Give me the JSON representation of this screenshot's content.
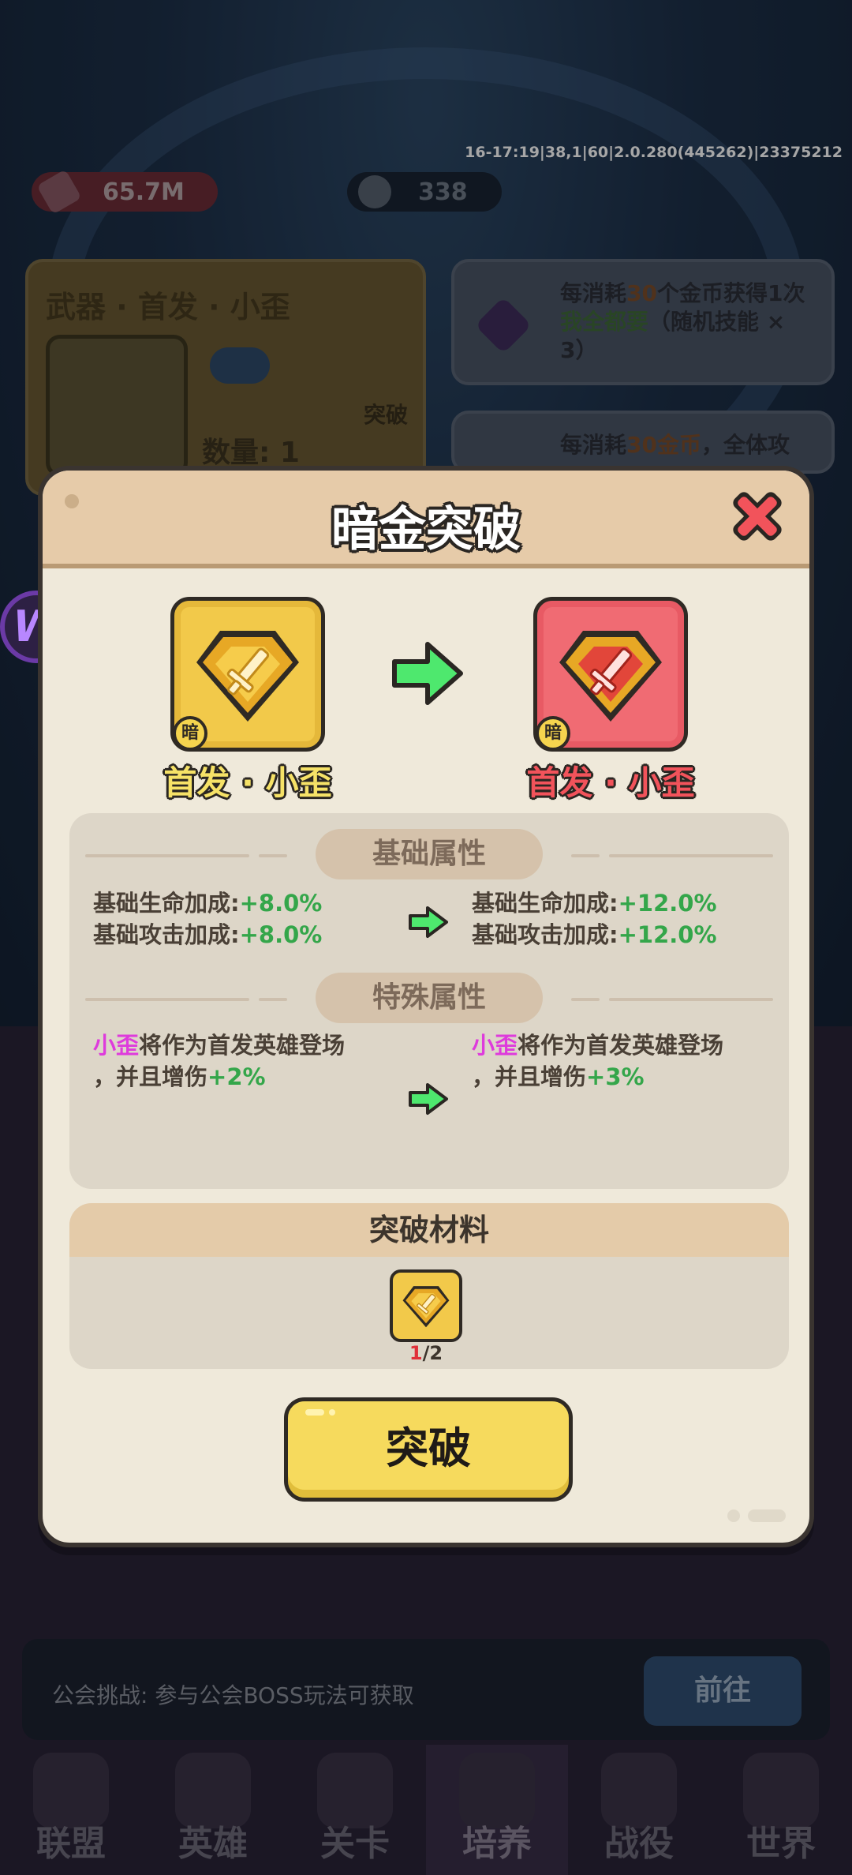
{
  "status": {
    "version_text": "16-17:19|38,1|60|2.0.280(445262)|23375212"
  },
  "top_bar": {
    "power": "65.7M",
    "gems": "338"
  },
  "weapon_card": {
    "title": "武器 · 首发 · 小歪",
    "quantity_label": "数量: 1",
    "breakthrough_label": "突破"
  },
  "offers": [
    {
      "prefix": "每消耗",
      "amount": "30",
      "middle": "个金币获得1次",
      "highlight": "我全都要",
      "rest": "（随机技能 × 3）"
    },
    {
      "prefix": "每消耗",
      "amount": "30金币",
      "rest": "，全体攻"
    }
  ],
  "side_badge": "W",
  "modal": {
    "title": "暗金突破",
    "tag": "暗",
    "from_name": "首发 · 小歪",
    "to_name": "首发 · 小歪",
    "base_section": "基础属性",
    "special_section": "特殊属性",
    "base_before": [
      {
        "label": "基础生命加成:",
        "value": "+8.0%"
      },
      {
        "label": "基础攻击加成:",
        "value": "+8.0%"
      }
    ],
    "base_after": [
      {
        "label": "基础生命加成:",
        "value": "+12.0%"
      },
      {
        "label": "基础攻击加成:",
        "value": "+12.0%"
      }
    ],
    "special_before": {
      "hero": "小歪",
      "text1": "将作为首发英雄登场",
      "text2": "，并且增伤",
      "value": "+2%"
    },
    "special_after": {
      "hero": "小歪",
      "text1": "将作为首发英雄登场",
      "text2": "，并且增伤",
      "value": "+3%"
    },
    "material_title": "突破材料",
    "material_have": "1",
    "material_need": "/2",
    "button_label": "突破"
  },
  "guild": {
    "text": "公会挑战: 参与公会BOSS玩法可获取",
    "go_label": "前往"
  },
  "nav": [
    {
      "label": "联盟"
    },
    {
      "label": "英雄"
    },
    {
      "label": "关卡"
    },
    {
      "label": "培养"
    },
    {
      "label": "战役"
    },
    {
      "label": "世界"
    }
  ],
  "colors": {
    "accent_gold": "#f6da5d",
    "accent_red": "#f06b73",
    "bonus_green": "#34a64a",
    "hero_magenta": "#de3bdc",
    "modal_bg": "#efe9da"
  },
  "icons": {
    "close": "close-x-icon",
    "arrow": "green-arrow-icon",
    "item": "sword-emblem-icon"
  }
}
